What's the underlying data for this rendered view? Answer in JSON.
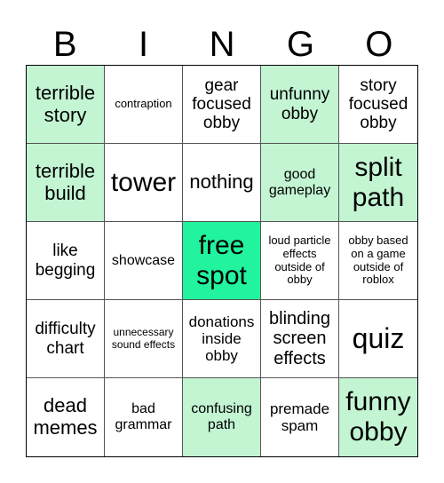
{
  "header": [
    "B",
    "I",
    "N",
    "G",
    "O"
  ],
  "colors": {
    "marked": "#c3f5d3",
    "free": "#22f39e",
    "unmarked": "#ffffff"
  },
  "cells": [
    {
      "text": "terrible story",
      "state": "marked"
    },
    {
      "text": "contraption",
      "state": "unmarked"
    },
    {
      "text": "gear focused obby",
      "state": "unmarked"
    },
    {
      "text": "unfunny obby",
      "state": "marked"
    },
    {
      "text": "story focused obby",
      "state": "unmarked"
    },
    {
      "text": "terrible build",
      "state": "marked"
    },
    {
      "text": "tower",
      "state": "unmarked"
    },
    {
      "text": "nothing",
      "state": "unmarked"
    },
    {
      "text": "good gameplay",
      "state": "marked"
    },
    {
      "text": "split path",
      "state": "marked"
    },
    {
      "text": "like begging",
      "state": "unmarked"
    },
    {
      "text": "showcase",
      "state": "unmarked"
    },
    {
      "text": "free spot",
      "state": "free"
    },
    {
      "text": "loud particle effects outside of obby",
      "state": "unmarked"
    },
    {
      "text": "obby based on a game outside of roblox",
      "state": "unmarked"
    },
    {
      "text": "difficulty chart",
      "state": "unmarked"
    },
    {
      "text": "unnecessary sound effects",
      "state": "unmarked"
    },
    {
      "text": "donations inside obby",
      "state": "unmarked"
    },
    {
      "text": "blinding screen effects",
      "state": "unmarked"
    },
    {
      "text": "quiz",
      "state": "unmarked"
    },
    {
      "text": "dead memes",
      "state": "unmarked"
    },
    {
      "text": "bad grammar",
      "state": "unmarked"
    },
    {
      "text": "confusing path",
      "state": "marked"
    },
    {
      "text": "premade spam",
      "state": "unmarked"
    },
    {
      "text": "funny obby",
      "state": "marked"
    }
  ]
}
